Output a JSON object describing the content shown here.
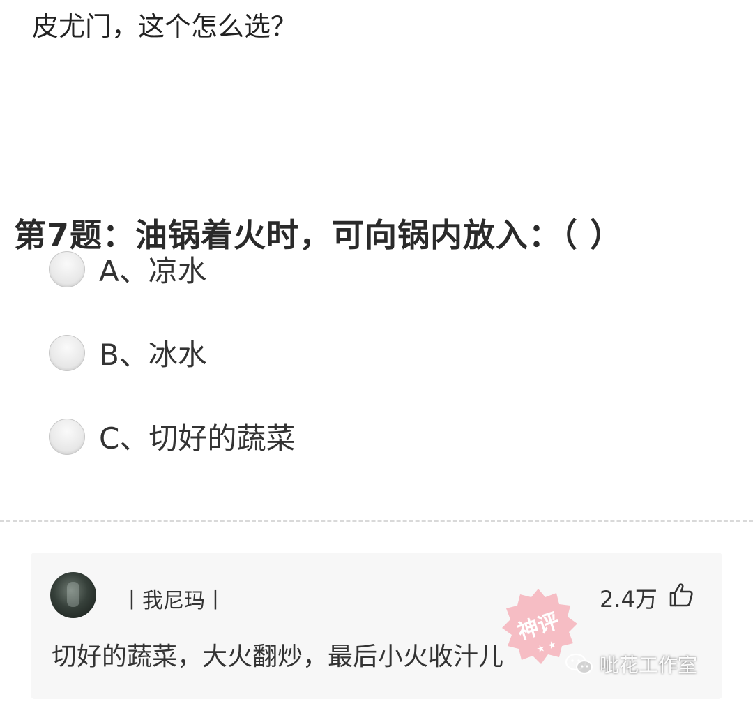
{
  "post": {
    "title": "皮尤门，这个怎么选？"
  },
  "quiz": {
    "question": "第7题：油锅着火时，可向锅内放入：（ ）",
    "options": [
      {
        "label": "A、凉水"
      },
      {
        "label": "B、冰水"
      },
      {
        "label": "C、切好的蔬菜"
      }
    ]
  },
  "comment": {
    "username": "丨我尼玛丨",
    "likes": "2.4万",
    "text": "切好的蔬菜，大火翻炒，最后小火收汁儿",
    "stamp_text": "神评",
    "icons": {
      "avatar": "user-avatar",
      "like": "thumbs-up-icon",
      "stamp": "top-comment-stamp"
    }
  },
  "watermark": {
    "text": "呲花工作室",
    "icon": "wechat-icon"
  },
  "colors": {
    "text": "#222222",
    "option_text": "#333333",
    "comment_bg": "#f7f7f7",
    "stamp": "#f28c9a",
    "divider": "#d9d9d9"
  }
}
